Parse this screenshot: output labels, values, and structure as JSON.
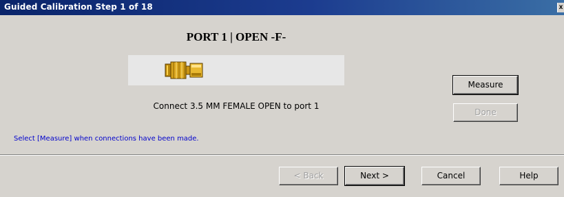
{
  "window": {
    "title": "Guided Calibration Step 1 of 18",
    "close_glyph": "x"
  },
  "step": {
    "port_title": "PORT 1 | OPEN -F-",
    "connector_icon": "sma-female-open-connector-icon",
    "instruction": "Connect 3.5 MM FEMALE OPEN to port 1"
  },
  "side_buttons": {
    "measure": "Measure",
    "done": "Done"
  },
  "status": "Select [Measure] when connections have been made.",
  "nav_buttons": {
    "back": "< Back",
    "next": "Next >",
    "cancel": "Cancel",
    "help": "Help"
  },
  "colors": {
    "title_bar": "#0a246a",
    "dialog_bg": "#d6d3ce",
    "status_text": "#0000cc",
    "connector_gold": "#d9a520"
  }
}
